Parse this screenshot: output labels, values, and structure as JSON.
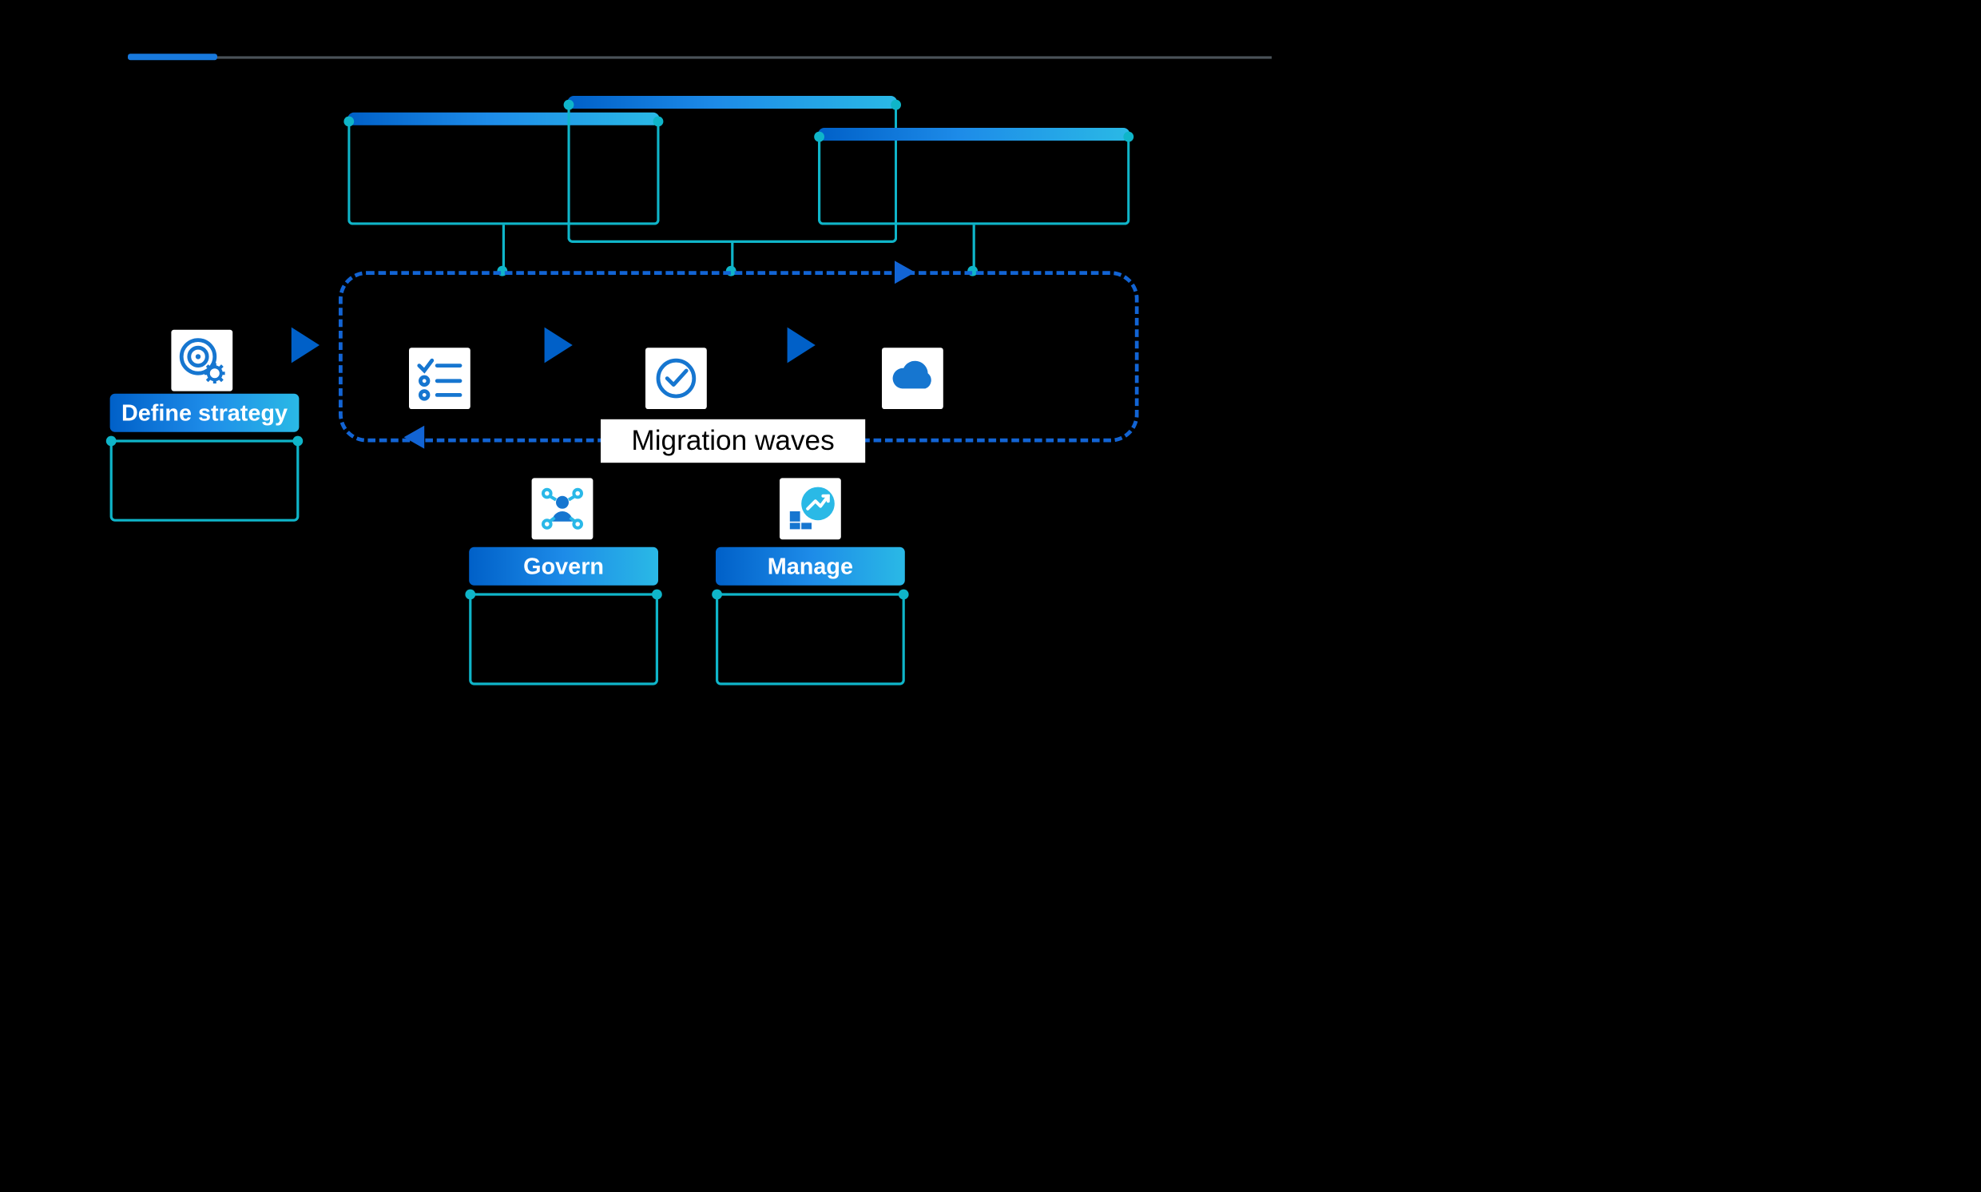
{
  "progress": {
    "percent": 8
  },
  "top_boxes": {
    "box1": {
      "label": ""
    },
    "box2": {
      "label": ""
    },
    "box3": {
      "label": ""
    }
  },
  "strategy": {
    "pill_label": "Define strategy",
    "icon_name": "target-gear-icon"
  },
  "migration_loop": {
    "title": "Migration waves",
    "step1_icon": "checklist-icon",
    "step2_icon": "checkmark-circle-icon",
    "step3_icon": "cloud-icon"
  },
  "govern": {
    "pill_label": "Govern",
    "icon_name": "governance-people-icon"
  },
  "manage": {
    "pill_label": "Manage",
    "icon_name": "manage-growth-icon"
  }
}
